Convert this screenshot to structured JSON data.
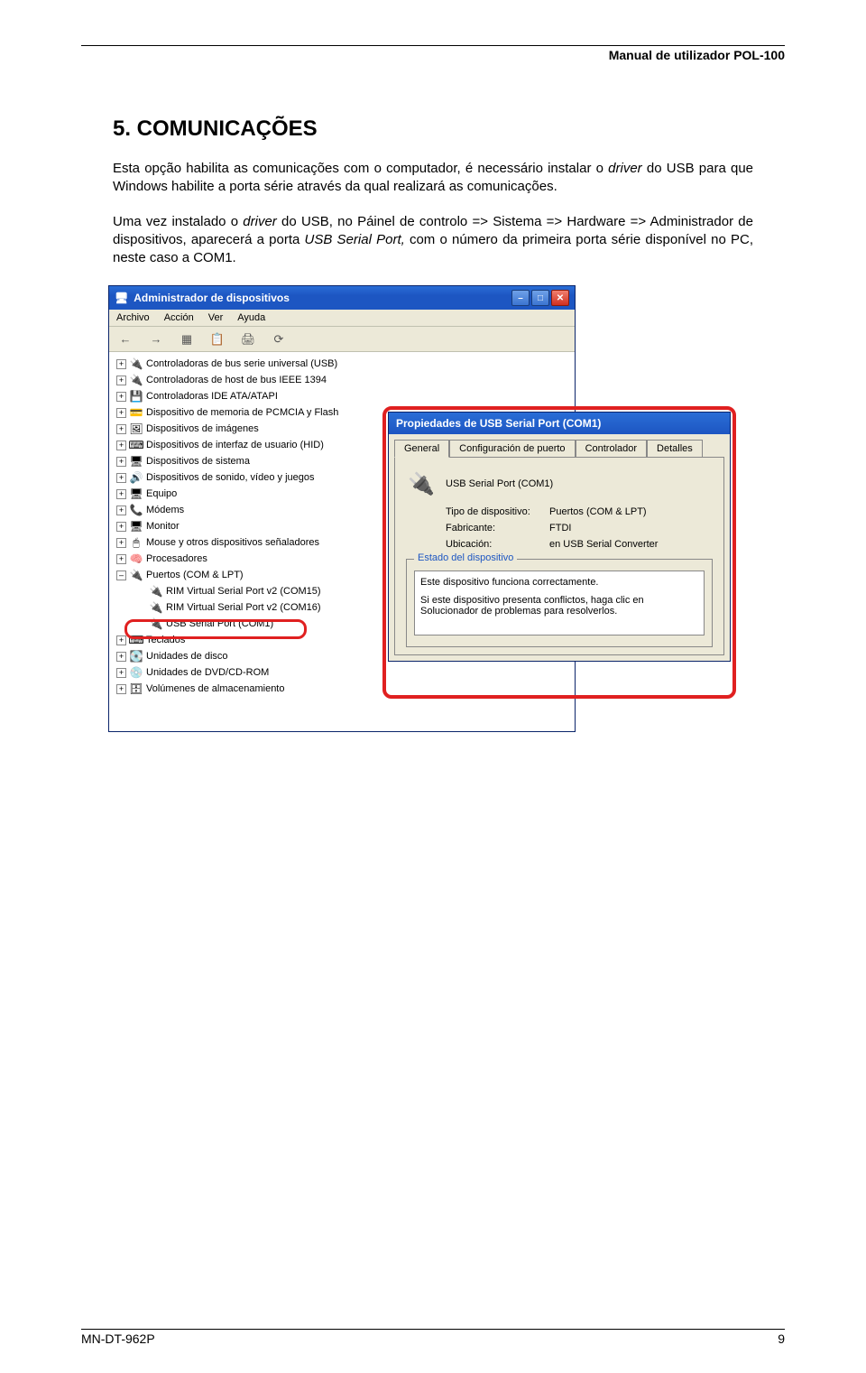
{
  "header": {
    "title": "Manual de utilizador POL-100"
  },
  "section": {
    "title": "5. COMUNICAÇÕES",
    "para1_a": "Esta opção habilita as comunicações com o computador, é necessário instalar o ",
    "para1_driver": "driver",
    "para1_b": " do USB para que Windows habilite a porta série através da qual realizará as comunicações.",
    "para2_a": "Uma vez instalado o ",
    "para2_driver": "driver",
    "para2_b": " do USB, no Páinel de controlo => Sistema => Hardware => Administrador de dispositivos, aparecerá a porta ",
    "para2_usb": "USB Serial Port,",
    "para2_c": " com o número da primeira porta série disponível no PC, neste caso a COM1."
  },
  "device_manager": {
    "title": "Administrador de dispositivos",
    "menu": [
      "Archivo",
      "Acción",
      "Ver",
      "Ayuda"
    ],
    "tree": [
      {
        "icon": "🔌",
        "label": "Controladoras de bus serie universal (USB)",
        "exp": "+"
      },
      {
        "icon": "🔌",
        "label": "Controladoras de host de bus IEEE 1394",
        "exp": "+"
      },
      {
        "icon": "💾",
        "label": "Controladoras IDE ATA/ATAPI",
        "exp": "+"
      },
      {
        "icon": "💳",
        "label": "Dispositivo de memoria de PCMCIA y Flash",
        "exp": "+"
      },
      {
        "icon": "🖼",
        "label": "Dispositivos de imágenes",
        "exp": "+"
      },
      {
        "icon": "⌨",
        "label": "Dispositivos de interfaz de usuario (HID)",
        "exp": "+"
      },
      {
        "icon": "🖥",
        "label": "Dispositivos de sistema",
        "exp": "+"
      },
      {
        "icon": "🔊",
        "label": "Dispositivos de sonido, vídeo y juegos",
        "exp": "+"
      },
      {
        "icon": "🖥",
        "label": "Equipo",
        "exp": "+"
      },
      {
        "icon": "📞",
        "label": "Módems",
        "exp": "+"
      },
      {
        "icon": "🖥",
        "label": "Monitor",
        "exp": "+"
      },
      {
        "icon": "🖱",
        "label": "Mouse y otros dispositivos señaladores",
        "exp": "+"
      },
      {
        "icon": "🧠",
        "label": "Procesadores",
        "exp": "+"
      }
    ],
    "ports_label": "Puertos (COM & LPT)",
    "ports_children": [
      "RIM Virtual Serial Port v2 (COM15)",
      "RIM Virtual Serial Port v2 (COM16)",
      "USB Serial Port (COM1)"
    ],
    "tree_after": [
      {
        "icon": "⌨",
        "label": "Teclados",
        "exp": "+"
      },
      {
        "icon": "💽",
        "label": "Unidades de disco",
        "exp": "+"
      },
      {
        "icon": "💿",
        "label": "Unidades de DVD/CD-ROM",
        "exp": "+"
      },
      {
        "icon": "🗄",
        "label": "Volúmenes de almacenamiento",
        "exp": "+"
      }
    ]
  },
  "properties": {
    "title": "Propiedades de USB Serial Port (COM1)",
    "tabs": [
      "General",
      "Configuración de puerto",
      "Controlador",
      "Detalles"
    ],
    "name": "USB Serial Port (COM1)",
    "fields": {
      "tipo_k": "Tipo de dispositivo:",
      "tipo_v": "Puertos (COM & LPT)",
      "fab_k": "Fabricante:",
      "fab_v": "FTDI",
      "ubi_k": "Ubicación:",
      "ubi_v": "en USB Serial Converter"
    },
    "status_legend": "Estado del dispositivo",
    "status_1": "Este dispositivo funciona correctamente.",
    "status_2": "Si este dispositivo presenta conflictos, haga clic en Solucionador de problemas para resolverlos."
  },
  "footer": {
    "left": "MN-DT-962P",
    "right": "9"
  }
}
